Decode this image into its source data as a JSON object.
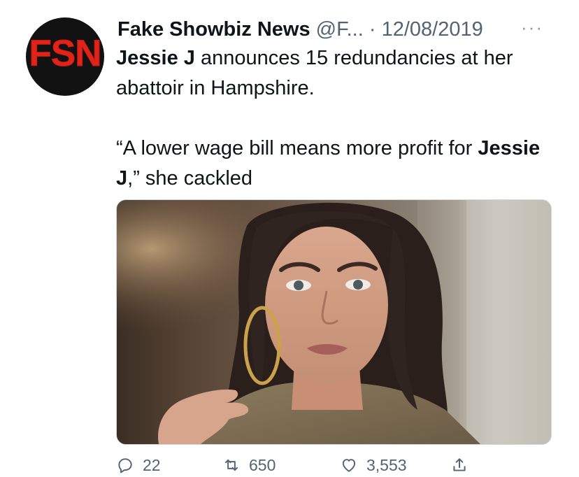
{
  "tweet": {
    "avatar_text": "FSN",
    "author_name": "Fake Showbiz News",
    "author_handle": "@F...",
    "separator": "·",
    "date": "12/08/2019",
    "more": "···",
    "line1_bold": "Jessie J",
    "line1_rest": " announces 15 redundancies at her abattoir in Hampshire.",
    "line2_start": "“A lower wage bill means more profit for ",
    "line2_bold": "Jessie J",
    "line2_end": ",” she cackled",
    "media_description_icon": "photo-of-woman-with-hoop-earring"
  },
  "actions": {
    "replies": "22",
    "retweets": "650",
    "likes": "3,553"
  },
  "colors": {
    "avatar_bg": "#121212",
    "avatar_text": "#e2231a",
    "secondary_text": "#536471"
  }
}
